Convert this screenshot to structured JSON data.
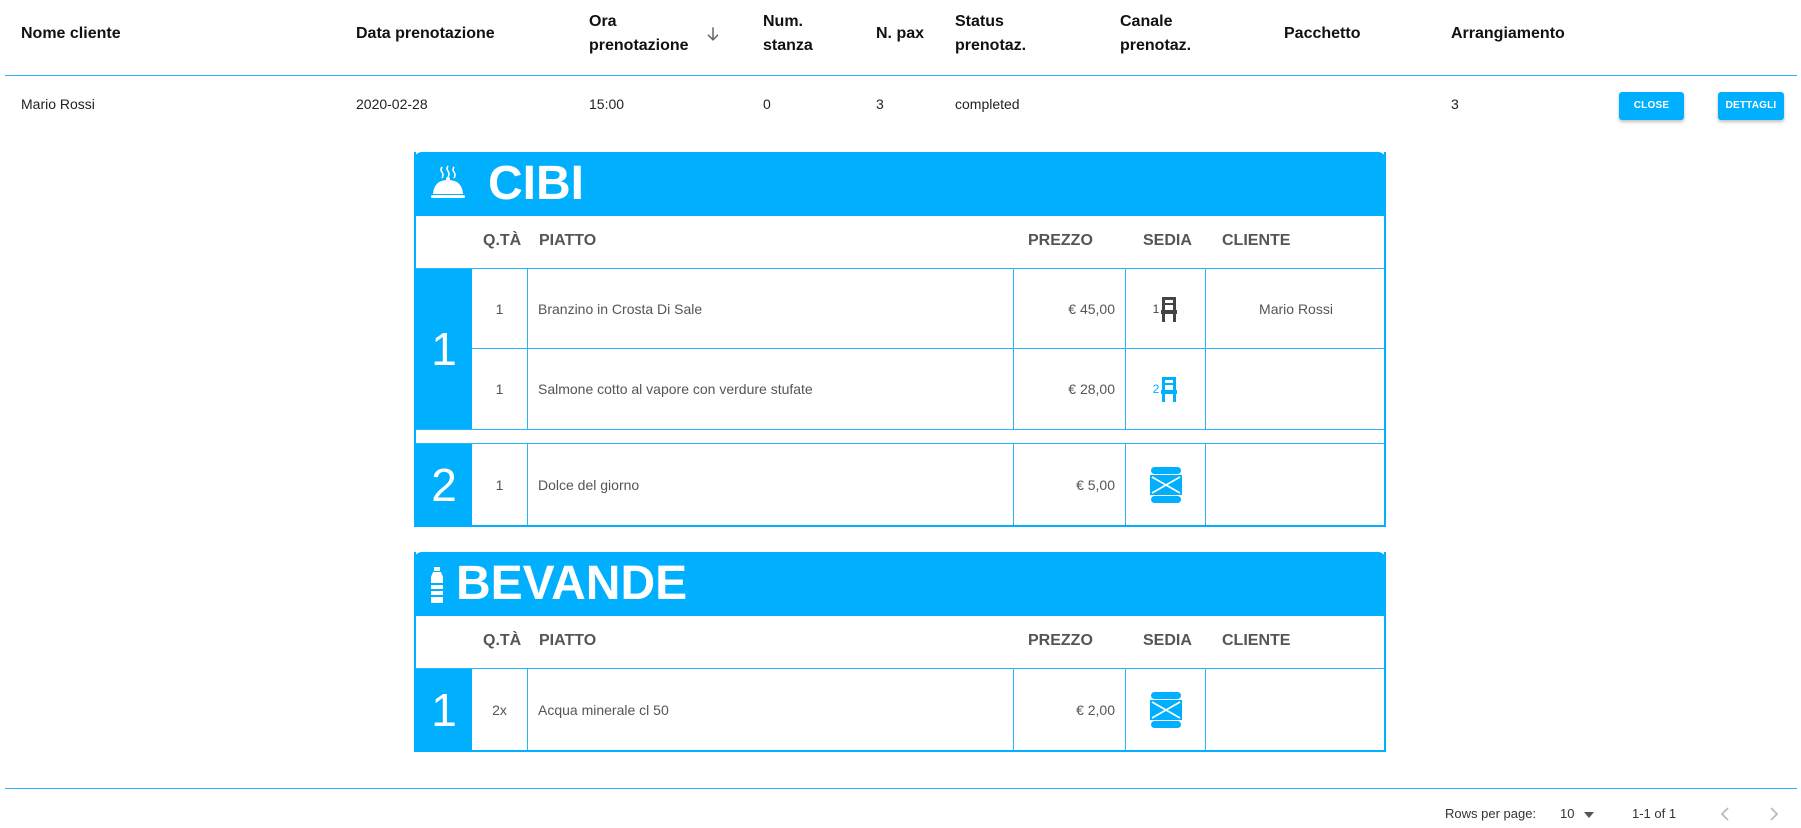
{
  "table": {
    "headers": {
      "client": "Nome cliente",
      "date": "Data prenotazione",
      "time_l1": "Ora",
      "time_l2": "prenotazione",
      "room_l1": "Num.",
      "room_l2": "stanza",
      "pax": "N. pax",
      "status_l1": "Status",
      "status_l2": "prenotaz.",
      "channel_l1": "Canale",
      "channel_l2": "prenotaz.",
      "package": "Pacchetto",
      "arrangement": "Arrangiamento"
    },
    "sort_icon": "arrow-down-icon",
    "row": {
      "client": "Mario Rossi",
      "date": "2020-02-28",
      "time": "15:00",
      "room": "0",
      "pax": "3",
      "status": "completed",
      "channel": "",
      "package": "",
      "arrangement": "3",
      "close_label": "CLOSE",
      "details_label": "DETTAGLI"
    }
  },
  "food": {
    "title": "CIBI",
    "icon": "cloche-icon",
    "columns": {
      "qty": "Q.TÀ",
      "dish": "PIATTO",
      "price": "PREZZO",
      "seat": "SEDIA",
      "client": "CLIENTE"
    },
    "courses": [
      {
        "number": "1",
        "items": [
          {
            "qty": "1",
            "dish": "Branzino in Crosta Di Sale",
            "price": "€ 45,00",
            "seat": "1",
            "seat_icon": "chair-icon",
            "client": "Mario Rossi"
          },
          {
            "qty": "1",
            "dish": "Salmone cotto al vapore con verdure stufate",
            "price": "€ 28,00",
            "seat": "2",
            "seat_icon": "chair-icon",
            "client": ""
          }
        ]
      },
      {
        "number": "2",
        "items": [
          {
            "qty": "1",
            "dish": "Dolce del giorno",
            "price": "€ 5,00",
            "seat": "",
            "seat_icon": "shared-table-icon",
            "client": ""
          }
        ]
      }
    ]
  },
  "drinks": {
    "title": "BEVANDE",
    "icon": "bottle-icon",
    "columns": {
      "qty": "Q.TÀ",
      "dish": "PIATTO",
      "price": "PREZZO",
      "seat": "SEDIA",
      "client": "CLIENTE"
    },
    "courses": [
      {
        "number": "1",
        "items": [
          {
            "qty": "2x",
            "dish": "Acqua minerale cl 50",
            "price": "€ 2,00",
            "seat": "",
            "seat_icon": "shared-table-icon",
            "client": ""
          }
        ]
      }
    ]
  },
  "pagination": {
    "rows_label": "Rows per page:",
    "rows_value": "10",
    "range": "1-1 of 1",
    "prev_icon": "chevron-left-icon",
    "next_icon": "chevron-right-icon"
  },
  "colors": {
    "accent": "#00b0ff",
    "line": "#29b6f6"
  }
}
